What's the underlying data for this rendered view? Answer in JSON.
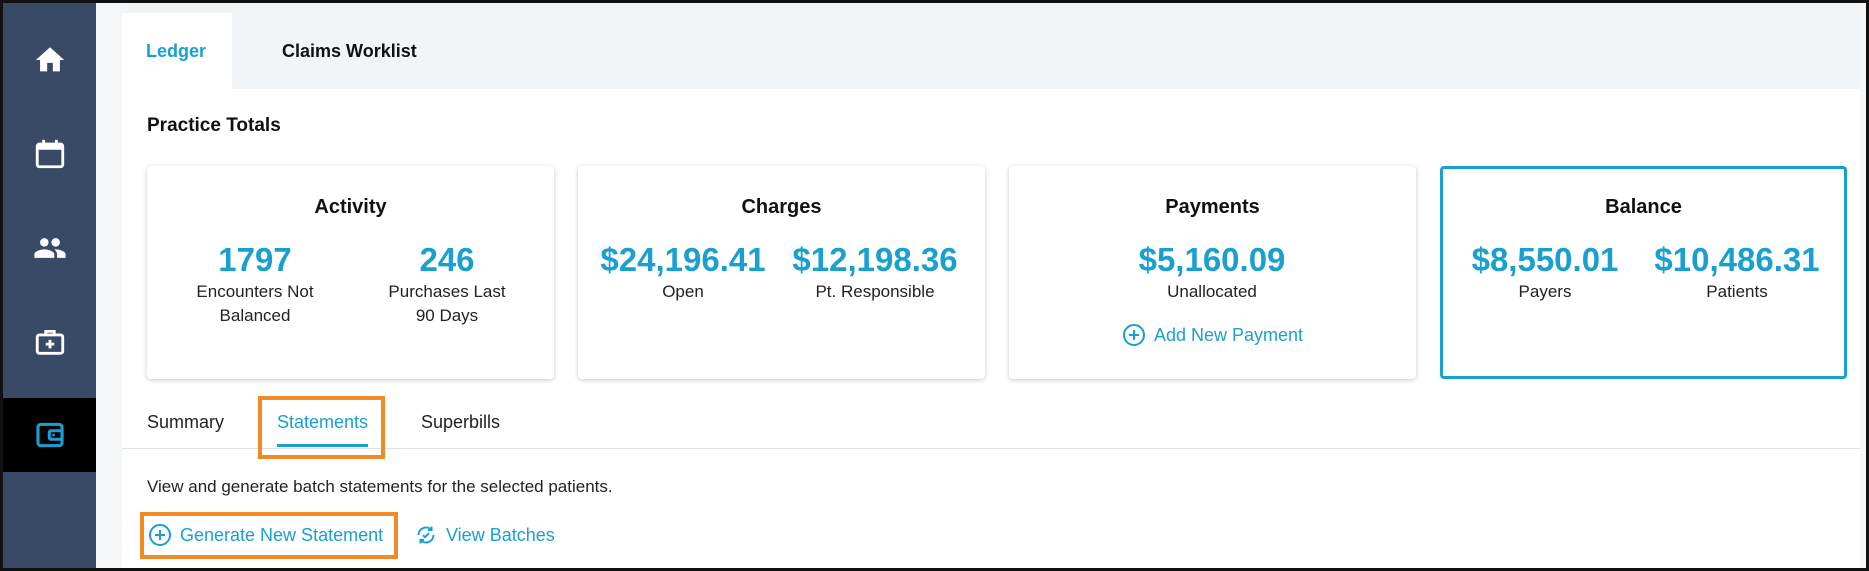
{
  "nav": {
    "items": [
      {
        "icon": "home-icon",
        "active": false
      },
      {
        "icon": "calendar-icon",
        "active": false
      },
      {
        "icon": "people-icon",
        "active": false
      },
      {
        "icon": "medical-bag-icon",
        "active": false
      },
      {
        "icon": "wallet-icon",
        "active": true
      }
    ]
  },
  "tabs": {
    "ledger": "Ledger",
    "claims": "Claims Worklist"
  },
  "practice_totals": {
    "title": "Practice Totals",
    "activity": {
      "title": "Activity",
      "encounters_value": "1797",
      "encounters_label": "Encounters Not Balanced",
      "purchases_value": "246",
      "purchases_label": "Purchases Last 90 Days"
    },
    "charges": {
      "title": "Charges",
      "open_value": "$24,196.41",
      "open_label": "Open",
      "pt_value": "$12,198.36",
      "pt_label": "Pt. Responsible"
    },
    "payments": {
      "title": "Payments",
      "unallocated_value": "$5,160.09",
      "unallocated_label": "Unallocated",
      "add_label": "Add New Payment"
    },
    "balance": {
      "title": "Balance",
      "payers_value": "$8,550.01",
      "payers_label": "Payers",
      "patients_value": "$10,486.31",
      "patients_label": "Patients"
    }
  },
  "subtabs": {
    "summary": "Summary",
    "statements": "Statements",
    "superbills": "Superbills"
  },
  "statements": {
    "description": "View and generate batch statements for the selected patients.",
    "generate_label": "Generate New Statement",
    "view_batches_label": "View Batches"
  },
  "colors": {
    "accent": "#1aa0d0",
    "sidebar": "#384a66",
    "highlight": "#f08a24"
  }
}
